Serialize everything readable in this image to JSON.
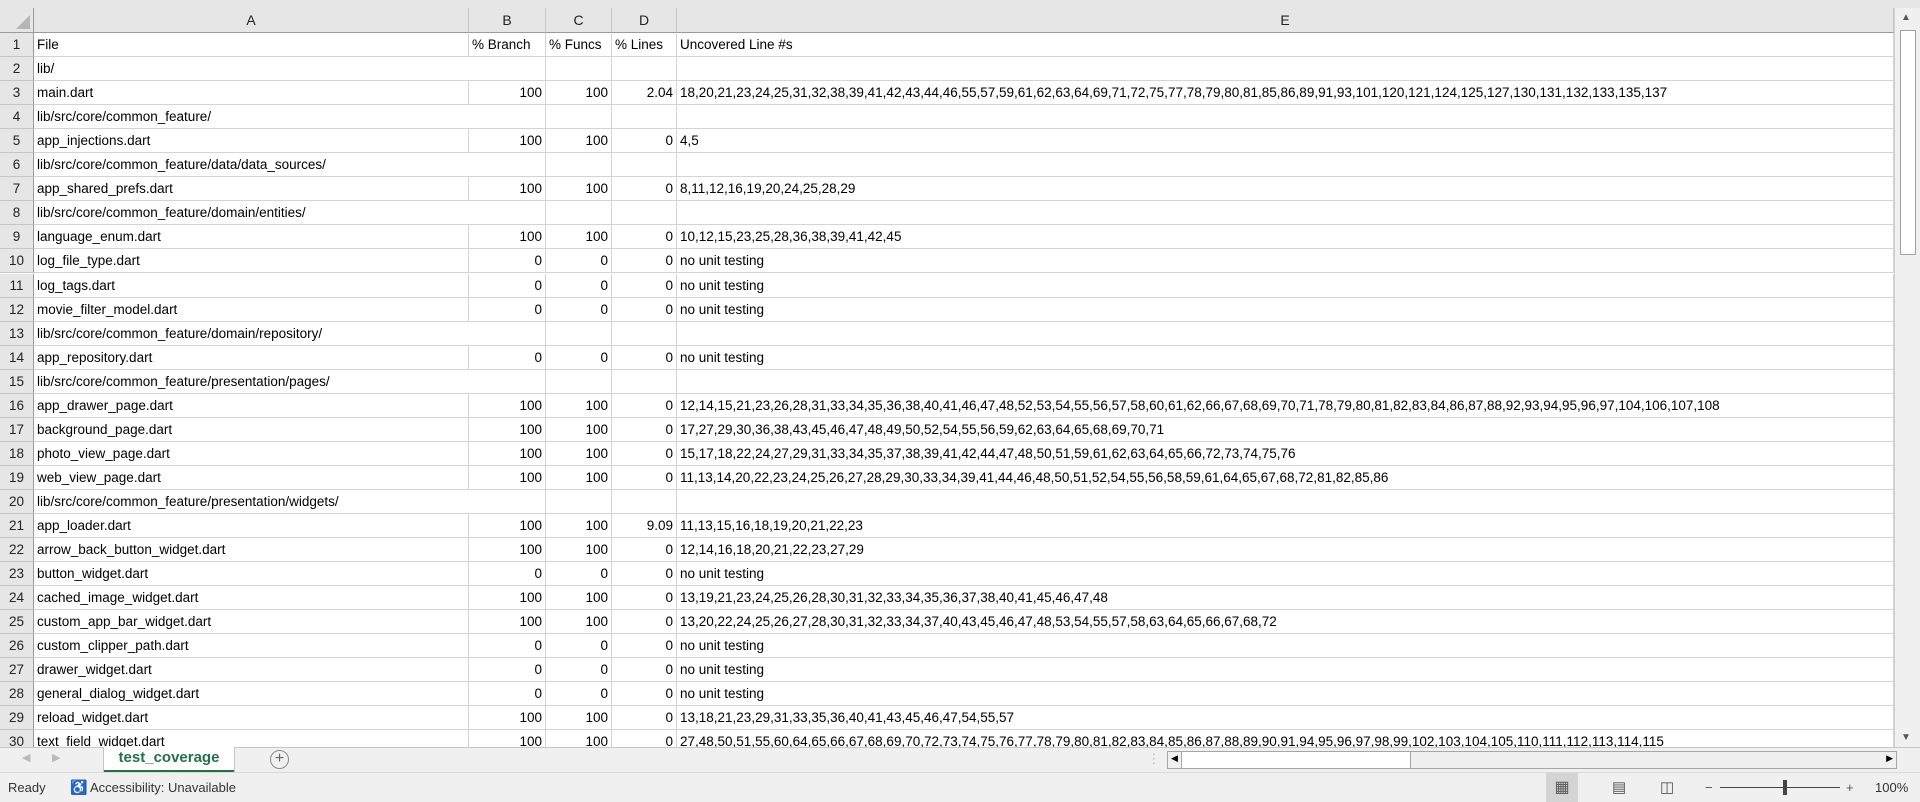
{
  "columns": [
    "A",
    "B",
    "C",
    "D",
    "E"
  ],
  "rows": [
    [
      "File",
      "% Branch",
      "% Funcs",
      "% Lines",
      "Uncovered Line #s"
    ],
    [
      "lib/",
      "",
      "",
      "",
      ""
    ],
    [
      "main.dart",
      "100",
      "100",
      "2.04",
      "18,20,21,23,24,25,31,32,38,39,41,42,43,44,46,55,57,59,61,62,63,64,69,71,72,75,77,78,79,80,81,85,86,89,91,93,101,120,121,124,125,127,130,131,132,133,135,137"
    ],
    [
      "lib/src/core/common_feature/",
      "",
      "",
      "",
      ""
    ],
    [
      "app_injections.dart",
      "100",
      "100",
      "0",
      "4,5"
    ],
    [
      "lib/src/core/common_feature/data/data_sources/",
      "",
      "",
      "",
      ""
    ],
    [
      "app_shared_prefs.dart",
      "100",
      "100",
      "0",
      "8,11,12,16,19,20,24,25,28,29"
    ],
    [
      "lib/src/core/common_feature/domain/entities/",
      "",
      "",
      "",
      ""
    ],
    [
      "language_enum.dart",
      "100",
      "100",
      "0",
      "10,12,15,23,25,28,36,38,39,41,42,45"
    ],
    [
      "log_file_type.dart",
      "0",
      "0",
      "0",
      "no unit testing"
    ],
    [
      "log_tags.dart",
      "0",
      "0",
      "0",
      "no unit testing"
    ],
    [
      "movie_filter_model.dart",
      "0",
      "0",
      "0",
      "no unit testing"
    ],
    [
      "lib/src/core/common_feature/domain/repository/",
      "",
      "",
      "",
      ""
    ],
    [
      "app_repository.dart",
      "0",
      "0",
      "0",
      "no unit testing"
    ],
    [
      "lib/src/core/common_feature/presentation/pages/",
      "",
      "",
      "",
      ""
    ],
    [
      "app_drawer_page.dart",
      "100",
      "100",
      "0",
      "12,14,15,21,23,26,28,31,33,34,35,36,38,40,41,46,47,48,52,53,54,55,56,57,58,60,61,62,66,67,68,69,70,71,78,79,80,81,82,83,84,86,87,88,92,93,94,95,96,97,104,106,107,108"
    ],
    [
      "background_page.dart",
      "100",
      "100",
      "0",
      "17,27,29,30,36,38,43,45,46,47,48,49,50,52,54,55,56,59,62,63,64,65,68,69,70,71"
    ],
    [
      "photo_view_page.dart",
      "100",
      "100",
      "0",
      "15,17,18,22,24,27,29,31,33,34,35,37,38,39,41,42,44,47,48,50,51,59,61,62,63,64,65,66,72,73,74,75,76"
    ],
    [
      "web_view_page.dart",
      "100",
      "100",
      "0",
      "11,13,14,20,22,23,24,25,26,27,28,29,30,33,34,39,41,44,46,48,50,51,52,54,55,56,58,59,61,64,65,67,68,72,81,82,85,86"
    ],
    [
      "lib/src/core/common_feature/presentation/widgets/",
      "",
      "",
      "",
      ""
    ],
    [
      "app_loader.dart",
      "100",
      "100",
      "9.09",
      "11,13,15,16,18,19,20,21,22,23"
    ],
    [
      "arrow_back_button_widget.dart",
      "100",
      "100",
      "0",
      "12,14,16,18,20,21,22,23,27,29"
    ],
    [
      "button_widget.dart",
      "0",
      "0",
      "0",
      "no unit testing"
    ],
    [
      "cached_image_widget.dart",
      "100",
      "100",
      "0",
      "13,19,21,23,24,25,26,28,30,31,32,33,34,35,36,37,38,40,41,45,46,47,48"
    ],
    [
      "custom_app_bar_widget.dart",
      "100",
      "100",
      "0",
      "13,20,22,24,25,26,27,28,30,31,32,33,34,37,40,43,45,46,47,48,53,54,55,57,58,63,64,65,66,67,68,72"
    ],
    [
      "custom_clipper_path.dart",
      "0",
      "0",
      "0",
      "no unit testing"
    ],
    [
      "drawer_widget.dart",
      "0",
      "0",
      "0",
      "no unit testing"
    ],
    [
      "general_dialog_widget.dart",
      "0",
      "0",
      "0",
      "no unit testing"
    ],
    [
      "reload_widget.dart",
      "100",
      "100",
      "0",
      "13,18,21,23,29,31,33,35,36,40,41,43,45,46,47,54,55,57"
    ],
    [
      "text_field_widget.dart",
      "100",
      "100",
      "0",
      "27,48,50,51,55,60,64,65,66,67,68,69,70,72,73,74,75,76,77,78,79,80,81,82,83,84,85,86,87,88,89,90,91,94,95,96,97,98,99,102,103,104,105,110,111,112,113,114,115"
    ]
  ],
  "sheet_tab": "test_coverage",
  "status": {
    "ready": "Ready",
    "accessibility": "Accessibility: Unavailable",
    "zoom": "100%",
    "zoom_level_percent": 100
  },
  "icons": {
    "accessibility": "accessibility-icon",
    "add_sheet": "plus-circle-icon",
    "views": [
      "normal-view-icon",
      "page-layout-icon",
      "page-break-icon"
    ]
  },
  "colors": {
    "accent": "#217346",
    "header_bg": "#e6e6e6"
  }
}
